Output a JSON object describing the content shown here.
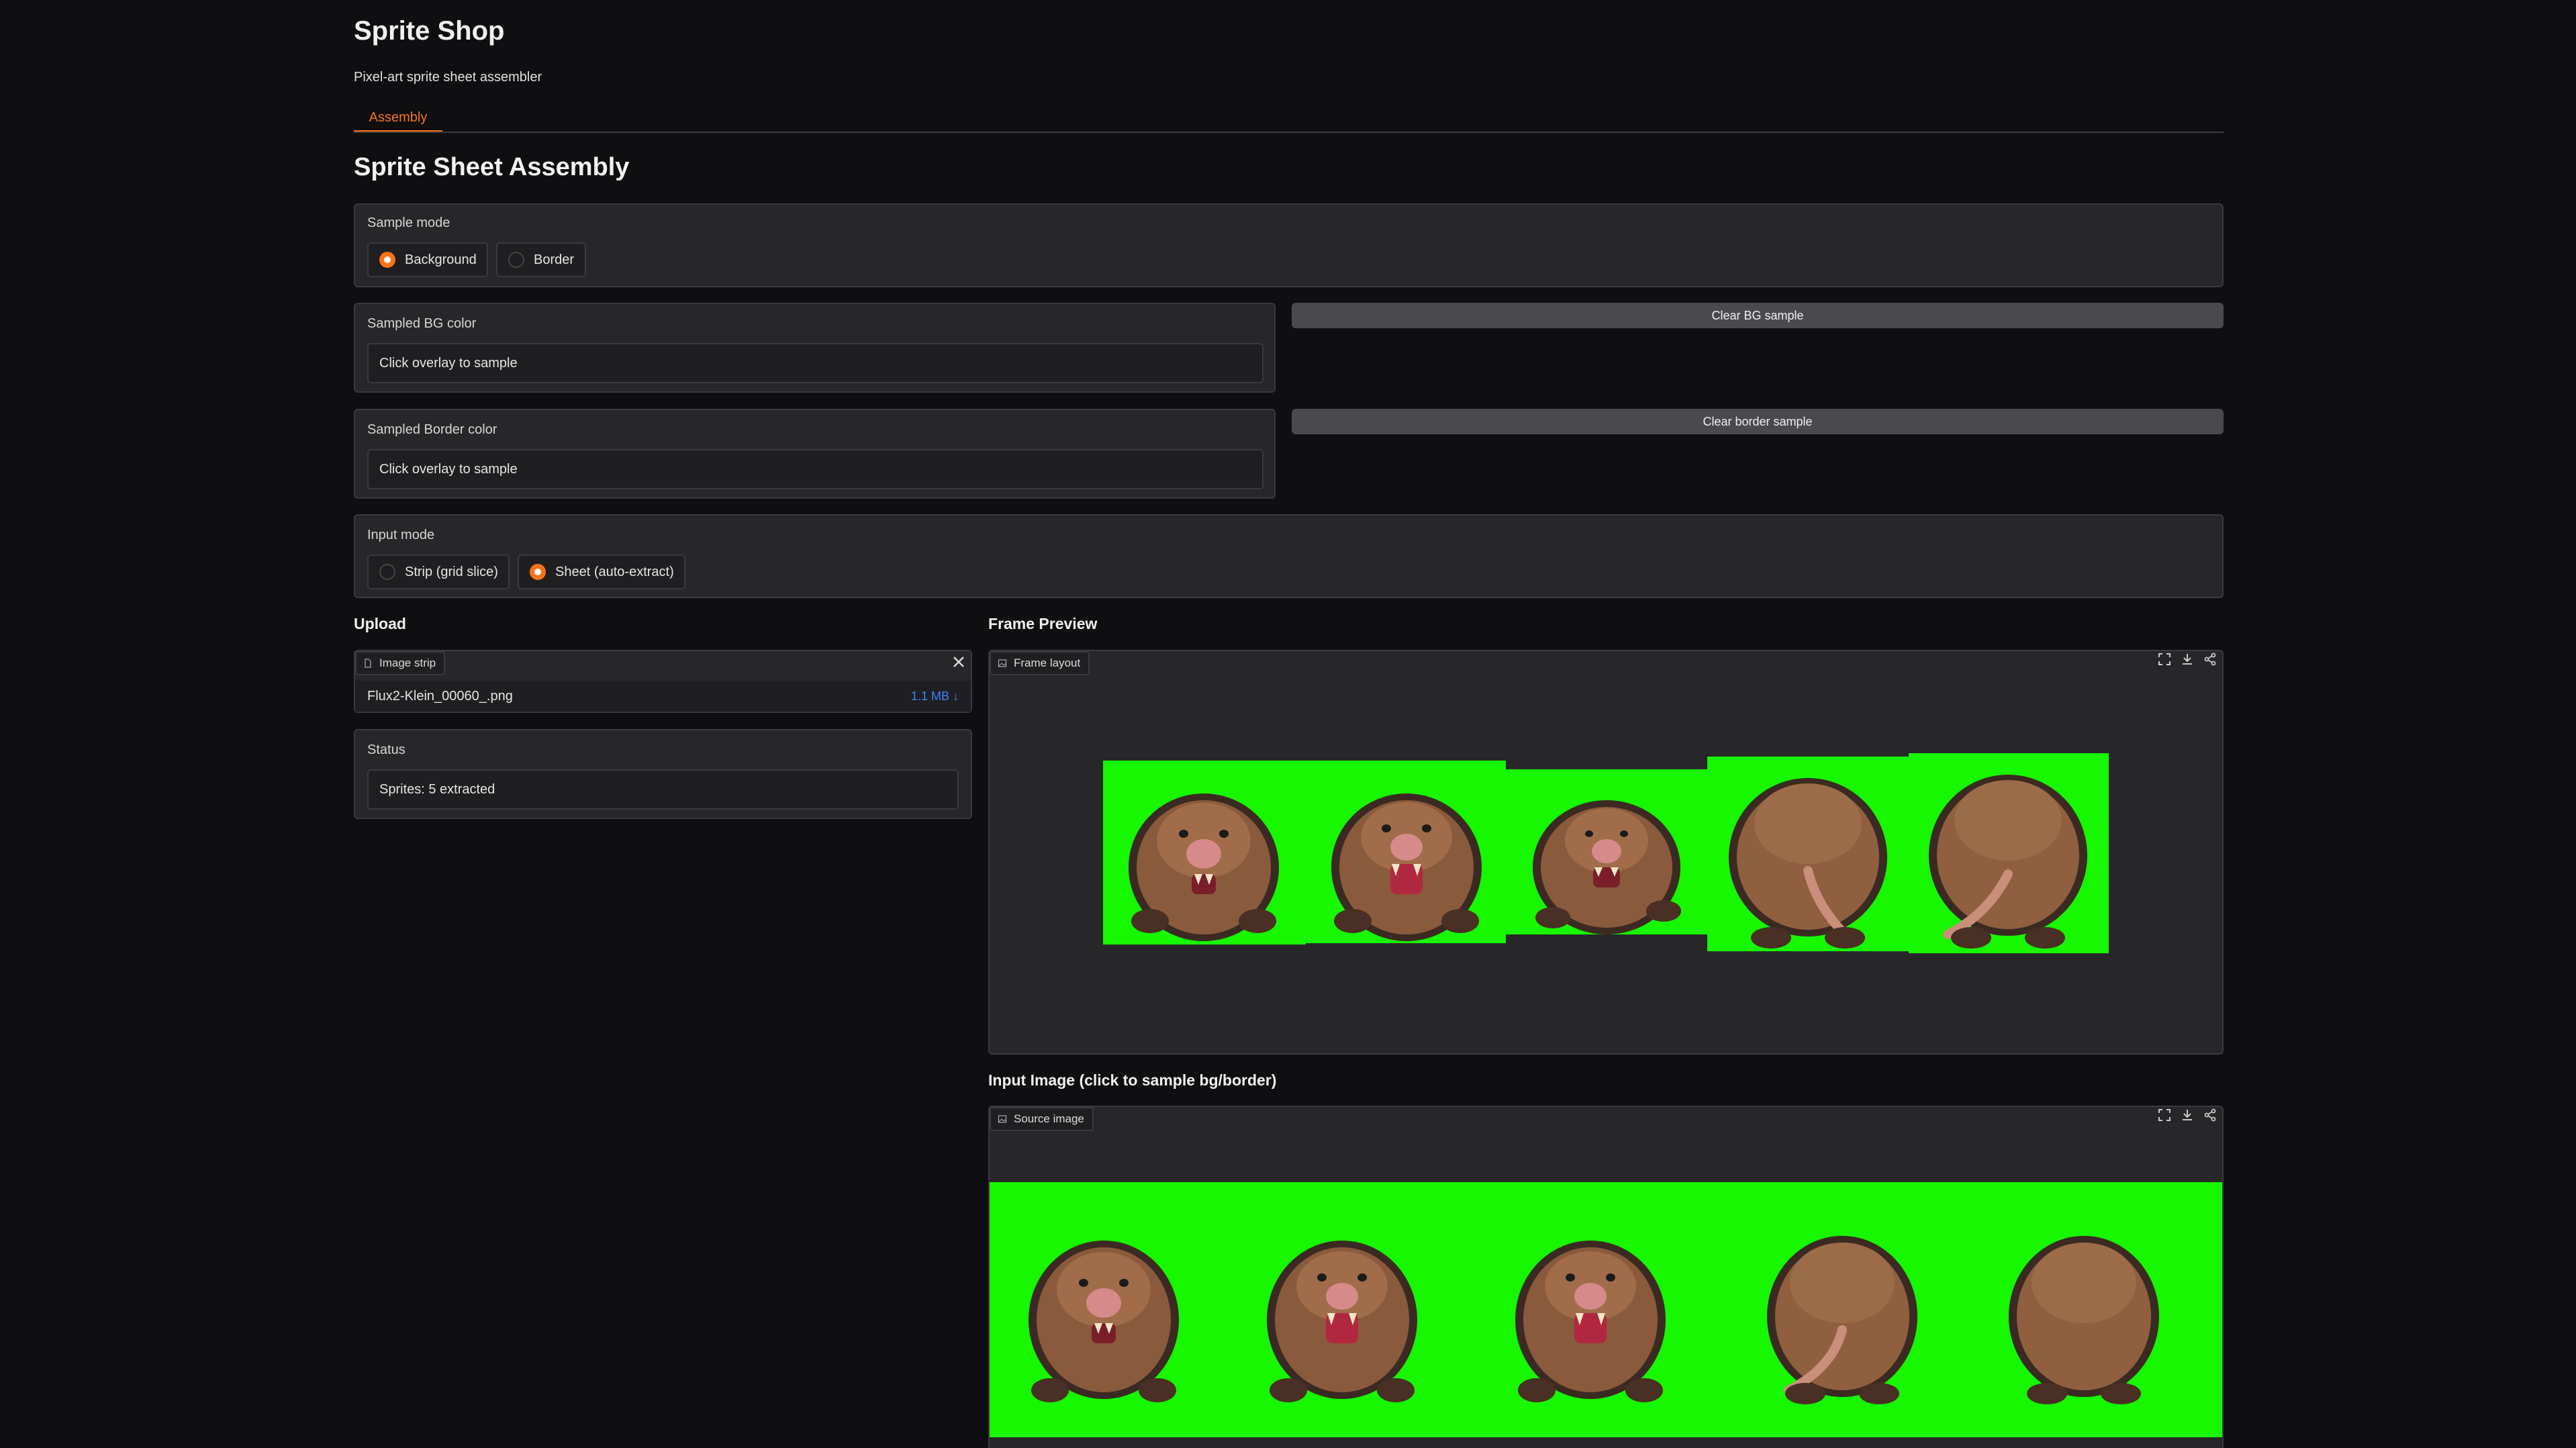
{
  "app": {
    "title": "Sprite Shop",
    "subtitle": "Pixel-art sprite sheet assembler",
    "tabs": [
      {
        "label": "Assembly",
        "active": true
      }
    ]
  },
  "section_title": "Sprite Sheet Assembly",
  "sample_mode": {
    "label": "Sample mode",
    "options": [
      "Background",
      "Border"
    ],
    "selected": "Background"
  },
  "sampled_bg": {
    "label": "Sampled BG color",
    "value": "Click overlay to sample",
    "button": "Clear BG sample"
  },
  "sampled_border": {
    "label": "Sampled Border color",
    "value": "Click overlay to sample",
    "button": "Clear border sample"
  },
  "input_mode": {
    "label": "Input mode",
    "options": [
      "Strip (grid slice)",
      "Sheet (auto-extract)"
    ],
    "selected": "Sheet (auto-extract)"
  },
  "upload": {
    "heading": "Upload",
    "chip": "Image strip",
    "file_name": "Flux2-Klein_00060_.png",
    "file_size": "1.1 MB ↓"
  },
  "status": {
    "label": "Status",
    "value": "Sprites: 5 extracted"
  },
  "frame_preview": {
    "heading": "Frame Preview",
    "chip": "Frame layout",
    "frames": [
      "mole-front-idle",
      "mole-front-roar",
      "mole-front-crouch",
      "mole-back-1",
      "mole-back-2"
    ]
  },
  "input_image": {
    "heading": "Input Image (click to sample bg/border)",
    "chip": "Source image",
    "sprites": [
      "mole-front-idle",
      "mole-front-roar",
      "mole-front-crouch",
      "mole-back-1",
      "mole-back-2"
    ]
  },
  "colors": {
    "accent": "#f97316",
    "chroma_green": "#16f700",
    "background": "#0f0f12",
    "panel": "#27272a",
    "link": "#3b82f6"
  },
  "icons": {
    "fullscreen": "fullscreen-icon",
    "download": "download-icon",
    "share": "share-icon",
    "close": "close-icon",
    "file": "file-icon",
    "image": "image-icon"
  }
}
